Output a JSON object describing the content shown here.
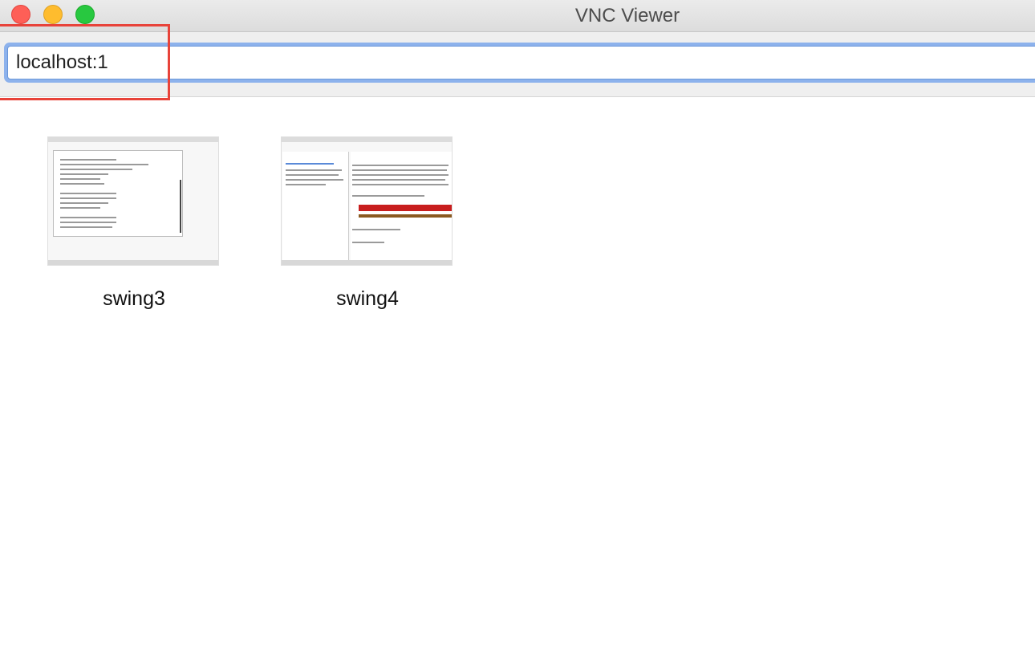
{
  "window": {
    "title": "VNC Viewer"
  },
  "toolbar": {
    "search": {
      "value": "localhost:1",
      "placeholder": ""
    }
  },
  "connections": [
    {
      "name": "swing3"
    },
    {
      "name": "swing4"
    }
  ],
  "colors": {
    "highlight": "#e8433a",
    "focus_ring": "#8db2ec",
    "traffic_close": "#fe5f57",
    "traffic_minimize": "#febc2e",
    "traffic_maximize": "#28c840"
  }
}
